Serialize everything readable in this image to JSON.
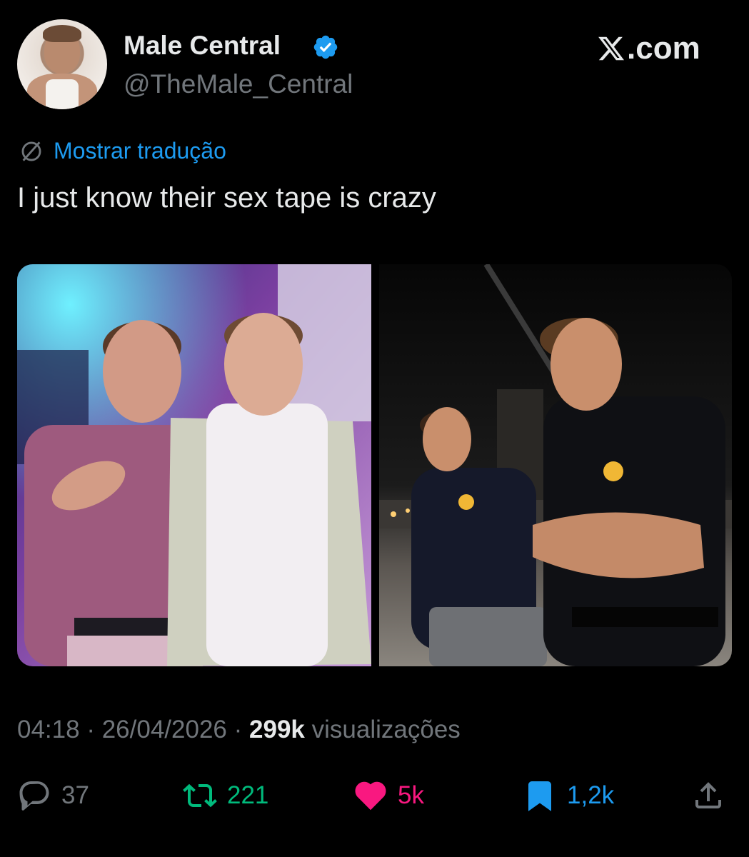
{
  "author": {
    "display_name": "Male Central",
    "handle": "@TheMale_Central",
    "verified": true
  },
  "brand": {
    "label": ".com"
  },
  "tweet": {
    "translate_label": "Mostrar tradução",
    "text": "I just know their sex tape is crazy"
  },
  "meta": {
    "time": "04:18",
    "separator": "·",
    "date": "26/04/2026",
    "views_count": "299k",
    "views_label": "visualizações"
  },
  "actions": {
    "replies": "37",
    "reposts": "221",
    "likes": "5k",
    "bookmarks": "1,2k"
  },
  "icons": {
    "verified": "verified-badge-icon",
    "x_logo": "x-logo-icon",
    "translate": "translate-globe-icon",
    "reply": "reply-icon",
    "repost": "repost-icon",
    "like": "heart-icon",
    "bookmark": "bookmark-icon",
    "share": "share-icon"
  },
  "colors": {
    "background": "#000000",
    "text": "#e7e9ea",
    "muted": "#71767b",
    "link": "#1d9bf0",
    "verified": "#1d9bf0",
    "repost": "#00ba7c",
    "like": "#f91880",
    "bookmark": "#1d9bf0"
  }
}
